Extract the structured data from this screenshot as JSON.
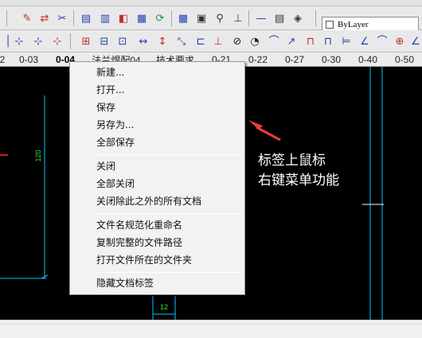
{
  "toolbar": {
    "layer_select": "ByLayer"
  },
  "tabs": [
    {
      "label": "2",
      "active": false
    },
    {
      "label": "0-03",
      "active": false
    },
    {
      "label": "0-04",
      "active": true
    },
    {
      "label": "法兰焊配04",
      "active": false
    },
    {
      "label": "技术要求",
      "active": false
    },
    {
      "label": "0-21",
      "active": false
    },
    {
      "label": "0-22",
      "active": false
    },
    {
      "label": "0-27",
      "active": false
    },
    {
      "label": "0-30",
      "active": false
    },
    {
      "label": "0-40",
      "active": false
    },
    {
      "label": "0-50",
      "active": false
    }
  ],
  "context_menu": {
    "groups": [
      [
        "新建...",
        "打开...",
        "保存",
        "另存为...",
        "全部保存"
      ],
      [
        "关闭",
        "全部关闭",
        "关闭除此之外的所有文档"
      ],
      [
        "文件名规范化重命名",
        "复制完整的文件路径",
        "打开文件所在的文件夹"
      ],
      [
        "隐藏文档标签"
      ]
    ]
  },
  "annotation": {
    "line1": "标签上鼠标",
    "line2": "右键菜单功能",
    "color": "#ffffff",
    "arrow_color": "#e8403a"
  },
  "drawing": {
    "dim_vertical": "120",
    "dim_horizontal": "12",
    "dim_color": "#00c8ff",
    "dim_text_color": "#2ee62e"
  }
}
